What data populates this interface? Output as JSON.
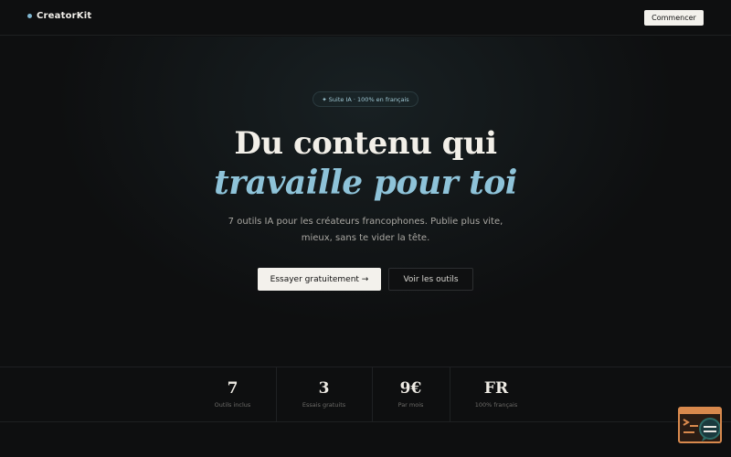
{
  "nav": {
    "brand": "CreatorKit",
    "cta_label": "Commencer"
  },
  "hero": {
    "badge": "✦ Suite IA · 100% en français",
    "title_line1": "Du contenu qui",
    "title_line2": "travaille pour toi",
    "subtitle": "7 outils IA pour les créateurs francophones. Publie plus vite, mieux, sans te vider la tête.",
    "primary_button": "Essayer gratuitement →",
    "secondary_button": "Voir les outils"
  },
  "stats": [
    {
      "value": "7",
      "label": "Outils inclus"
    },
    {
      "value": "3",
      "label": "Essais gratuits"
    },
    {
      "value": "9€",
      "label": "Par mois"
    },
    {
      "value": "FR",
      "label": "100% français"
    }
  ],
  "widget": {
    "icon": "chat-terminal-icon"
  },
  "colors": {
    "background": "#0e0f10",
    "accent": "#8ec3d9",
    "widget": "#d8894d"
  }
}
